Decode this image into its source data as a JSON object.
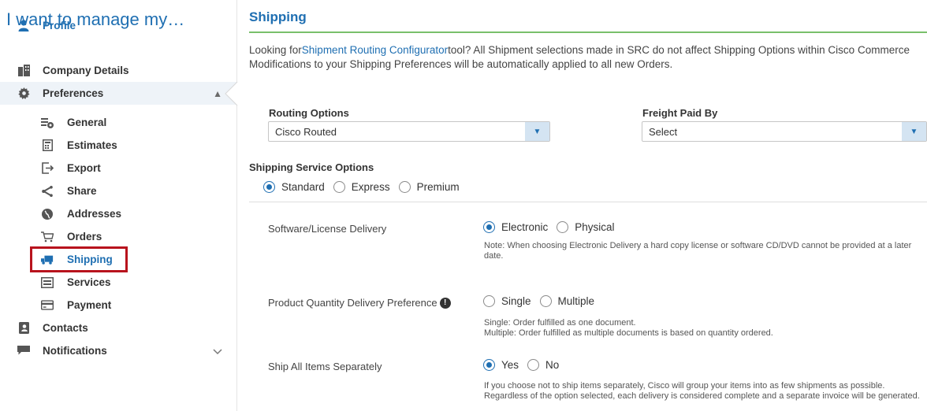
{
  "sidebar": {
    "title": "I want to manage my…",
    "items": [
      {
        "label": "Profile",
        "icon": "person-icon",
        "active": true
      },
      {
        "label": "Company Details",
        "icon": "building-icon"
      },
      {
        "label": "Preferences",
        "icon": "gear-icon",
        "expanded": true
      },
      {
        "label": "Contacts",
        "icon": "contact-card-icon"
      },
      {
        "label": "Notifications",
        "icon": "chat-bubble-icon"
      }
    ],
    "subitems": [
      {
        "label": "General",
        "icon": "settings-list-icon"
      },
      {
        "label": "Estimates",
        "icon": "calculator-icon"
      },
      {
        "label": "Export",
        "icon": "export-icon"
      },
      {
        "label": "Share",
        "icon": "share-icon"
      },
      {
        "label": "Addresses",
        "icon": "globe-icon"
      },
      {
        "label": "Orders",
        "icon": "cart-icon"
      },
      {
        "label": "Shipping",
        "icon": "truck-icon",
        "active": true
      },
      {
        "label": "Services",
        "icon": "services-icon"
      },
      {
        "label": "Payment",
        "icon": "credit-card-icon"
      }
    ],
    "highlight_color": "#b8131d"
  },
  "main": {
    "title": "Shipping",
    "intro": {
      "prefix": "Looking for",
      "link": "Shipment Routing Configurator",
      "suffix": "tool? All Shipment selections made in SRC do not affect Shipping Options within Cisco Commerce",
      "line2": "Modifications to your Shipping Preferences will be automatically applied to all new Orders."
    },
    "routing": {
      "label": "Routing Options",
      "value": "Cisco Routed"
    },
    "freight": {
      "label": "Freight Paid By",
      "value": "Select"
    },
    "service": {
      "label": "Shipping Service Options",
      "options": [
        "Standard",
        "Express",
        "Premium"
      ],
      "selected": "Standard"
    },
    "software": {
      "label": "Software/License Delivery",
      "options": [
        "Electronic",
        "Physical"
      ],
      "selected": "Electronic",
      "note": "Note: When choosing Electronic Delivery a hard copy license or software CD/DVD cannot be provided at a later date."
    },
    "quantity": {
      "label": "Product Quantity Delivery Preference",
      "info_icon": "!",
      "options": [
        "Single",
        "Multiple"
      ],
      "selected": null,
      "note_line1": "Single: Order fulfilled as one document.",
      "note_line2": "Multiple: Order fulfilled as multiple documents is based on quantity ordered."
    },
    "separate": {
      "label": "Ship All Items Separately",
      "options": [
        "Yes",
        "No"
      ],
      "selected": "Yes",
      "note": "If you choose not to ship items separately, Cisco will group your items into as few shipments as possible. Regardless of the option selected, each delivery is considered complete and a separate invoice will be generated."
    },
    "accent": "#1f6fb2",
    "rule_color": "#79c06b"
  }
}
